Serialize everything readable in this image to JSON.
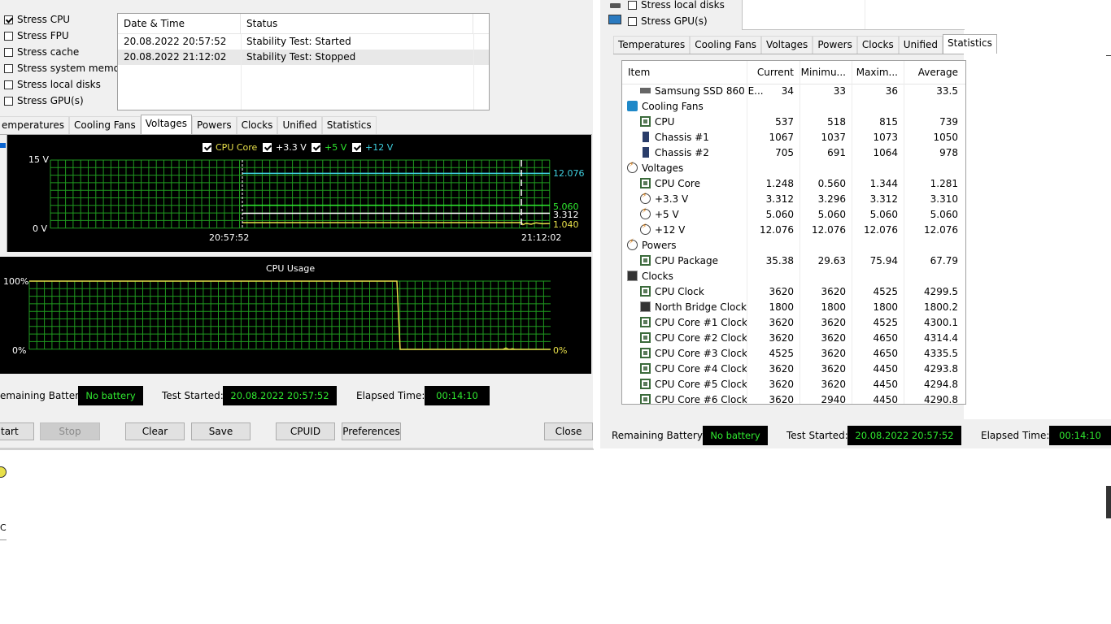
{
  "left_window": {
    "stress_options": [
      {
        "label": "Stress CPU",
        "checked": true
      },
      {
        "label": "Stress FPU",
        "checked": false
      },
      {
        "label": "Stress cache",
        "checked": false
      },
      {
        "label": "Stress system memory",
        "checked": false
      },
      {
        "label": "Stress local disks",
        "checked": false
      },
      {
        "label": "Stress GPU(s)",
        "checked": false
      }
    ],
    "log": {
      "headers": [
        "Date & Time",
        "Status"
      ],
      "rows": [
        {
          "datetime": "20.08.2022 20:57:52",
          "status": "Stability Test: Started"
        },
        {
          "datetime": "20.08.2022 21:12:02",
          "status": "Stability Test: Stopped"
        }
      ]
    },
    "tabs": [
      "Temperatures",
      "Cooling Fans",
      "Voltages",
      "Powers",
      "Clocks",
      "Unified",
      "Statistics"
    ],
    "tab_active": "Voltages",
    "tab_first_visible_text": "emperatures",
    "voltage_chart": {
      "legend": [
        {
          "label": "CPU Core",
          "color": "#e8e04a"
        },
        {
          "label": "+3.3 V",
          "color": "#ffffff"
        },
        {
          "label": "+5 V",
          "color": "#2fe82f"
        },
        {
          "label": "+12 V",
          "color": "#3fd0e0"
        }
      ],
      "y_top": "15 V",
      "y_bottom": "0 V",
      "x_start": "20:57:52",
      "x_end": "21:12:02",
      "right_values": [
        {
          "text": "12.076",
          "color": "#3fd0e0"
        },
        {
          "text": "5.060",
          "color": "#2fe82f"
        },
        {
          "text": "3.312",
          "color": "#ffffff"
        },
        {
          "text": "1.040",
          "color": "#e8e04a"
        }
      ]
    },
    "cpu_chart": {
      "title": "CPU Usage",
      "y_top": "100%",
      "y_bottom": "0%",
      "right_value": "0%"
    },
    "status_bar": {
      "battery_label": "emaining Battery:",
      "battery_value": "No battery",
      "started_label": "Test Started:",
      "started_value": "20.08.2022 20:57:52",
      "elapsed_label": "Elapsed Time:",
      "elapsed_value": "00:14:10"
    },
    "buttons": {
      "start": "tart",
      "stop": "Stop",
      "clear": "Clear",
      "save": "Save",
      "cpuid": "CPUID",
      "preferences": "Preferences",
      "close": "Close"
    }
  },
  "right_window": {
    "stress_options": [
      {
        "label": "Stress local disks",
        "checked": false
      },
      {
        "label": "Stress GPU(s)",
        "checked": false
      }
    ],
    "tabs": [
      "Temperatures",
      "Cooling Fans",
      "Voltages",
      "Powers",
      "Clocks",
      "Unified",
      "Statistics"
    ],
    "tab_active": "Statistics",
    "stats": {
      "headers": [
        "Item",
        "Current",
        "Minimu...",
        "Maxim...",
        "Average"
      ],
      "rows": [
        {
          "kind": "item",
          "icon": "disk-icon",
          "name": "Samsung SSD 860 E...",
          "current": "34",
          "min": "33",
          "max": "36",
          "avg": "33.5"
        },
        {
          "kind": "group",
          "icon": "fan-icon",
          "name": "Cooling Fans"
        },
        {
          "kind": "item",
          "icon": "chip-icon",
          "name": "CPU",
          "current": "537",
          "min": "518",
          "max": "815",
          "avg": "739"
        },
        {
          "kind": "item",
          "icon": "case-icon",
          "name": "Chassis #1",
          "current": "1067",
          "min": "1037",
          "max": "1073",
          "avg": "1050"
        },
        {
          "kind": "item",
          "icon": "case-icon",
          "name": "Chassis #2",
          "current": "705",
          "min": "691",
          "max": "1064",
          "avg": "978"
        },
        {
          "kind": "group",
          "icon": "voltage-icon",
          "name": "Voltages"
        },
        {
          "kind": "item",
          "icon": "chip-icon",
          "name": "CPU Core",
          "current": "1.248",
          "min": "0.560",
          "max": "1.344",
          "avg": "1.281"
        },
        {
          "kind": "item",
          "icon": "voltage-icon",
          "name": "+3.3 V",
          "current": "3.312",
          "min": "3.296",
          "max": "3.312",
          "avg": "3.310"
        },
        {
          "kind": "item",
          "icon": "voltage-icon",
          "name": "+5 V",
          "current": "5.060",
          "min": "5.060",
          "max": "5.060",
          "avg": "5.060"
        },
        {
          "kind": "item",
          "icon": "voltage-icon",
          "name": "+12 V",
          "current": "12.076",
          "min": "12.076",
          "max": "12.076",
          "avg": "12.076"
        },
        {
          "kind": "group",
          "icon": "voltage-icon",
          "name": "Powers"
        },
        {
          "kind": "item",
          "icon": "chip-icon",
          "name": "CPU Package",
          "current": "35.38",
          "min": "29.63",
          "max": "75.94",
          "avg": "67.79"
        },
        {
          "kind": "group",
          "icon": "clock-icon",
          "name": "Clocks"
        },
        {
          "kind": "item",
          "icon": "chip-icon",
          "name": "CPU Clock",
          "current": "3620",
          "min": "3620",
          "max": "4525",
          "avg": "4299.5"
        },
        {
          "kind": "item",
          "icon": "clock-icon",
          "name": "North Bridge Clock",
          "current": "1800",
          "min": "1800",
          "max": "1800",
          "avg": "1800.2"
        },
        {
          "kind": "item",
          "icon": "chip-icon",
          "name": "CPU Core #1 Clock",
          "current": "3620",
          "min": "3620",
          "max": "4525",
          "avg": "4300.1"
        },
        {
          "kind": "item",
          "icon": "chip-icon",
          "name": "CPU Core #2 Clock",
          "current": "3620",
          "min": "3620",
          "max": "4650",
          "avg": "4314.4"
        },
        {
          "kind": "item",
          "icon": "chip-icon",
          "name": "CPU Core #3 Clock",
          "current": "4525",
          "min": "3620",
          "max": "4650",
          "avg": "4335.5"
        },
        {
          "kind": "item",
          "icon": "chip-icon",
          "name": "CPU Core #4 Clock",
          "current": "3620",
          "min": "3620",
          "max": "4450",
          "avg": "4293.8"
        },
        {
          "kind": "item",
          "icon": "chip-icon",
          "name": "CPU Core #5 Clock",
          "current": "3620",
          "min": "3620",
          "max": "4450",
          "avg": "4294.8"
        },
        {
          "kind": "item",
          "icon": "chip-icon",
          "name": "CPU Core #6 Clock",
          "current": "3620",
          "min": "2940",
          "max": "4450",
          "avg": "4290.8"
        }
      ]
    },
    "status_bar": {
      "battery_label": "Remaining Battery:",
      "battery_value": "No battery",
      "started_label": "Test Started:",
      "started_value": "20.08.2022 20:57:52",
      "elapsed_label": "Elapsed Time:",
      "elapsed_value": "00:14:10"
    }
  },
  "bottom_left_fragment": "C"
}
